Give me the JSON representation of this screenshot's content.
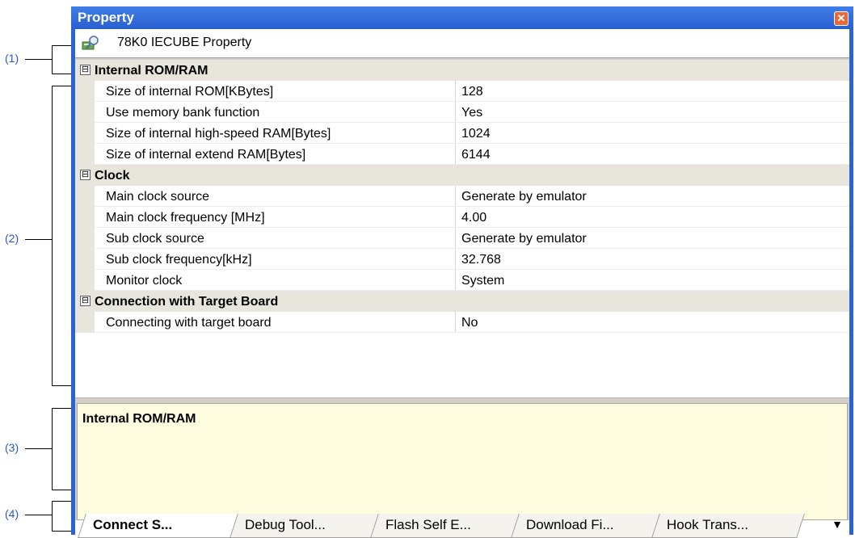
{
  "callouts": [
    "(1)",
    "(2)",
    "(3)",
    "(4)"
  ],
  "window": {
    "title": "Property",
    "close_glyph": "✕"
  },
  "header": {
    "title": "78K0 IECUBE Property",
    "icon": "property-search-icon"
  },
  "grid": {
    "categories": [
      {
        "toggle": "⊟",
        "label": "Internal ROM/RAM",
        "items": [
          {
            "name": "Size of internal ROM[KBytes]",
            "value": "128"
          },
          {
            "name": "Use memory bank function",
            "value": "Yes"
          },
          {
            "name": "Size of internal high-speed RAM[Bytes]",
            "value": "1024"
          },
          {
            "name": "Size of internal extend RAM[Bytes]",
            "value": "6144"
          }
        ]
      },
      {
        "toggle": "⊟",
        "label": "Clock",
        "items": [
          {
            "name": "Main clock source",
            "value": "Generate by emulator"
          },
          {
            "name": "Main clock frequency [MHz]",
            "value": "4.00"
          },
          {
            "name": "Sub clock source",
            "value": "Generate by emulator"
          },
          {
            "name": "Sub clock frequency[kHz]",
            "value": "32.768"
          },
          {
            "name": "Monitor clock",
            "value": "System"
          }
        ]
      },
      {
        "toggle": "⊟",
        "label": "Connection with Target Board",
        "items": [
          {
            "name": "Connecting with target board",
            "value": "No"
          }
        ]
      }
    ]
  },
  "description": {
    "title": "Internal ROM/RAM"
  },
  "tabs": [
    {
      "label": "Connect S...",
      "active": true
    },
    {
      "label": "Debug Tool...",
      "active": false
    },
    {
      "label": "Flash Self E...",
      "active": false
    },
    {
      "label": "Download Fi...",
      "active": false
    },
    {
      "label": "Hook Trans...",
      "active": false
    }
  ],
  "tab_overflow": "▼"
}
